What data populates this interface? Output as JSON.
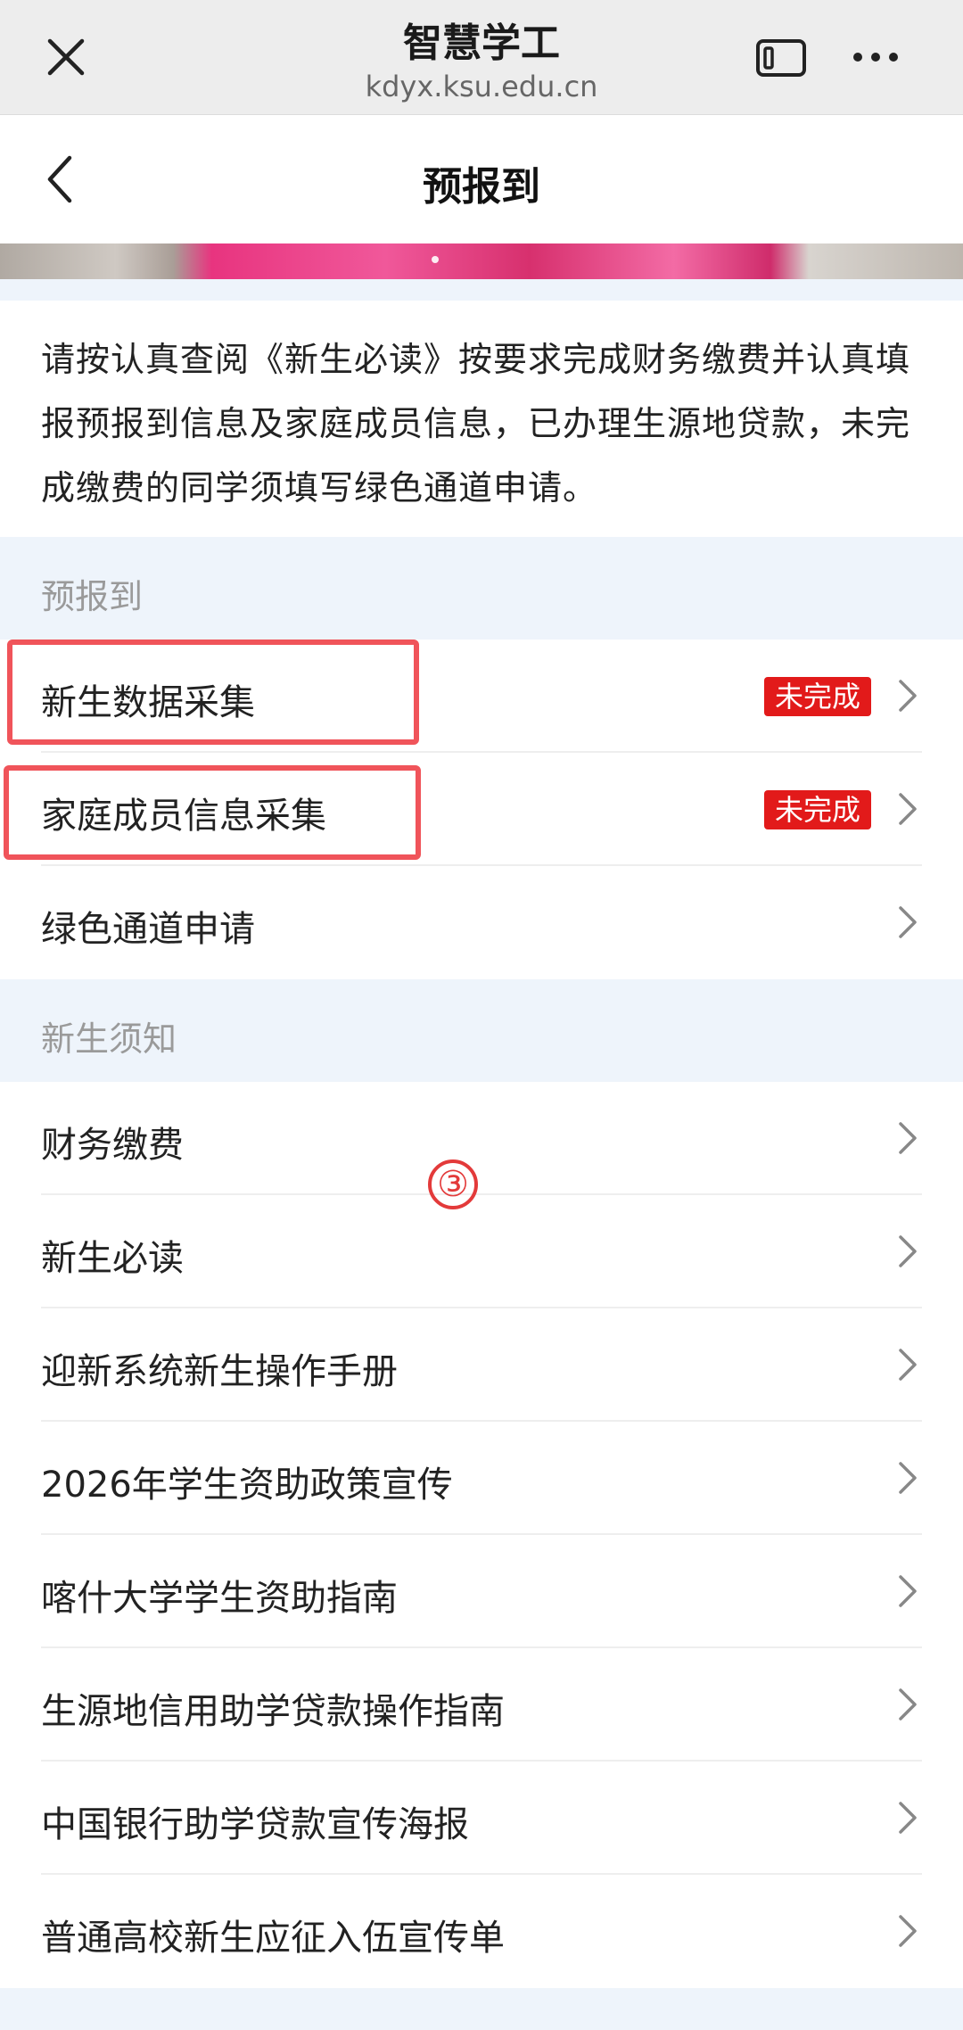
{
  "browser": {
    "title": "智慧学工",
    "url": "kdyx.ksu.edu.cn"
  },
  "header": {
    "title": "预报到"
  },
  "notice": {
    "text": "请按认真查阅《新生必读》按要求完成财务缴费并认真填报预报到信息及家庭成员信息，已办理生源地贷款，未完成缴费的同学须填写绿色通道申请。"
  },
  "sections": [
    {
      "title": "预报到",
      "items": [
        {
          "label": "新生数据采集",
          "badge": "未完成"
        },
        {
          "label": "家庭成员信息采集",
          "badge": "未完成"
        },
        {
          "label": "绿色通道申请"
        }
      ]
    },
    {
      "title": "新生须知",
      "items": [
        {
          "label": "财务缴费"
        },
        {
          "label": "新生必读"
        },
        {
          "label": "迎新系统新生操作手册"
        },
        {
          "label": "2026年学生资助政策宣传"
        },
        {
          "label": "喀什大学学生资助指南"
        },
        {
          "label": "生源地信用助学贷款操作指南"
        },
        {
          "label": "中国银行助学贷款宣传海报"
        },
        {
          "label": "普通高校新生应征入伍宣传单"
        }
      ]
    }
  ],
  "annotation": {
    "step": "③"
  },
  "colors": {
    "badge": "#e21a1a",
    "highlight": "#f0545a",
    "section_bg": "#eef4fb"
  }
}
